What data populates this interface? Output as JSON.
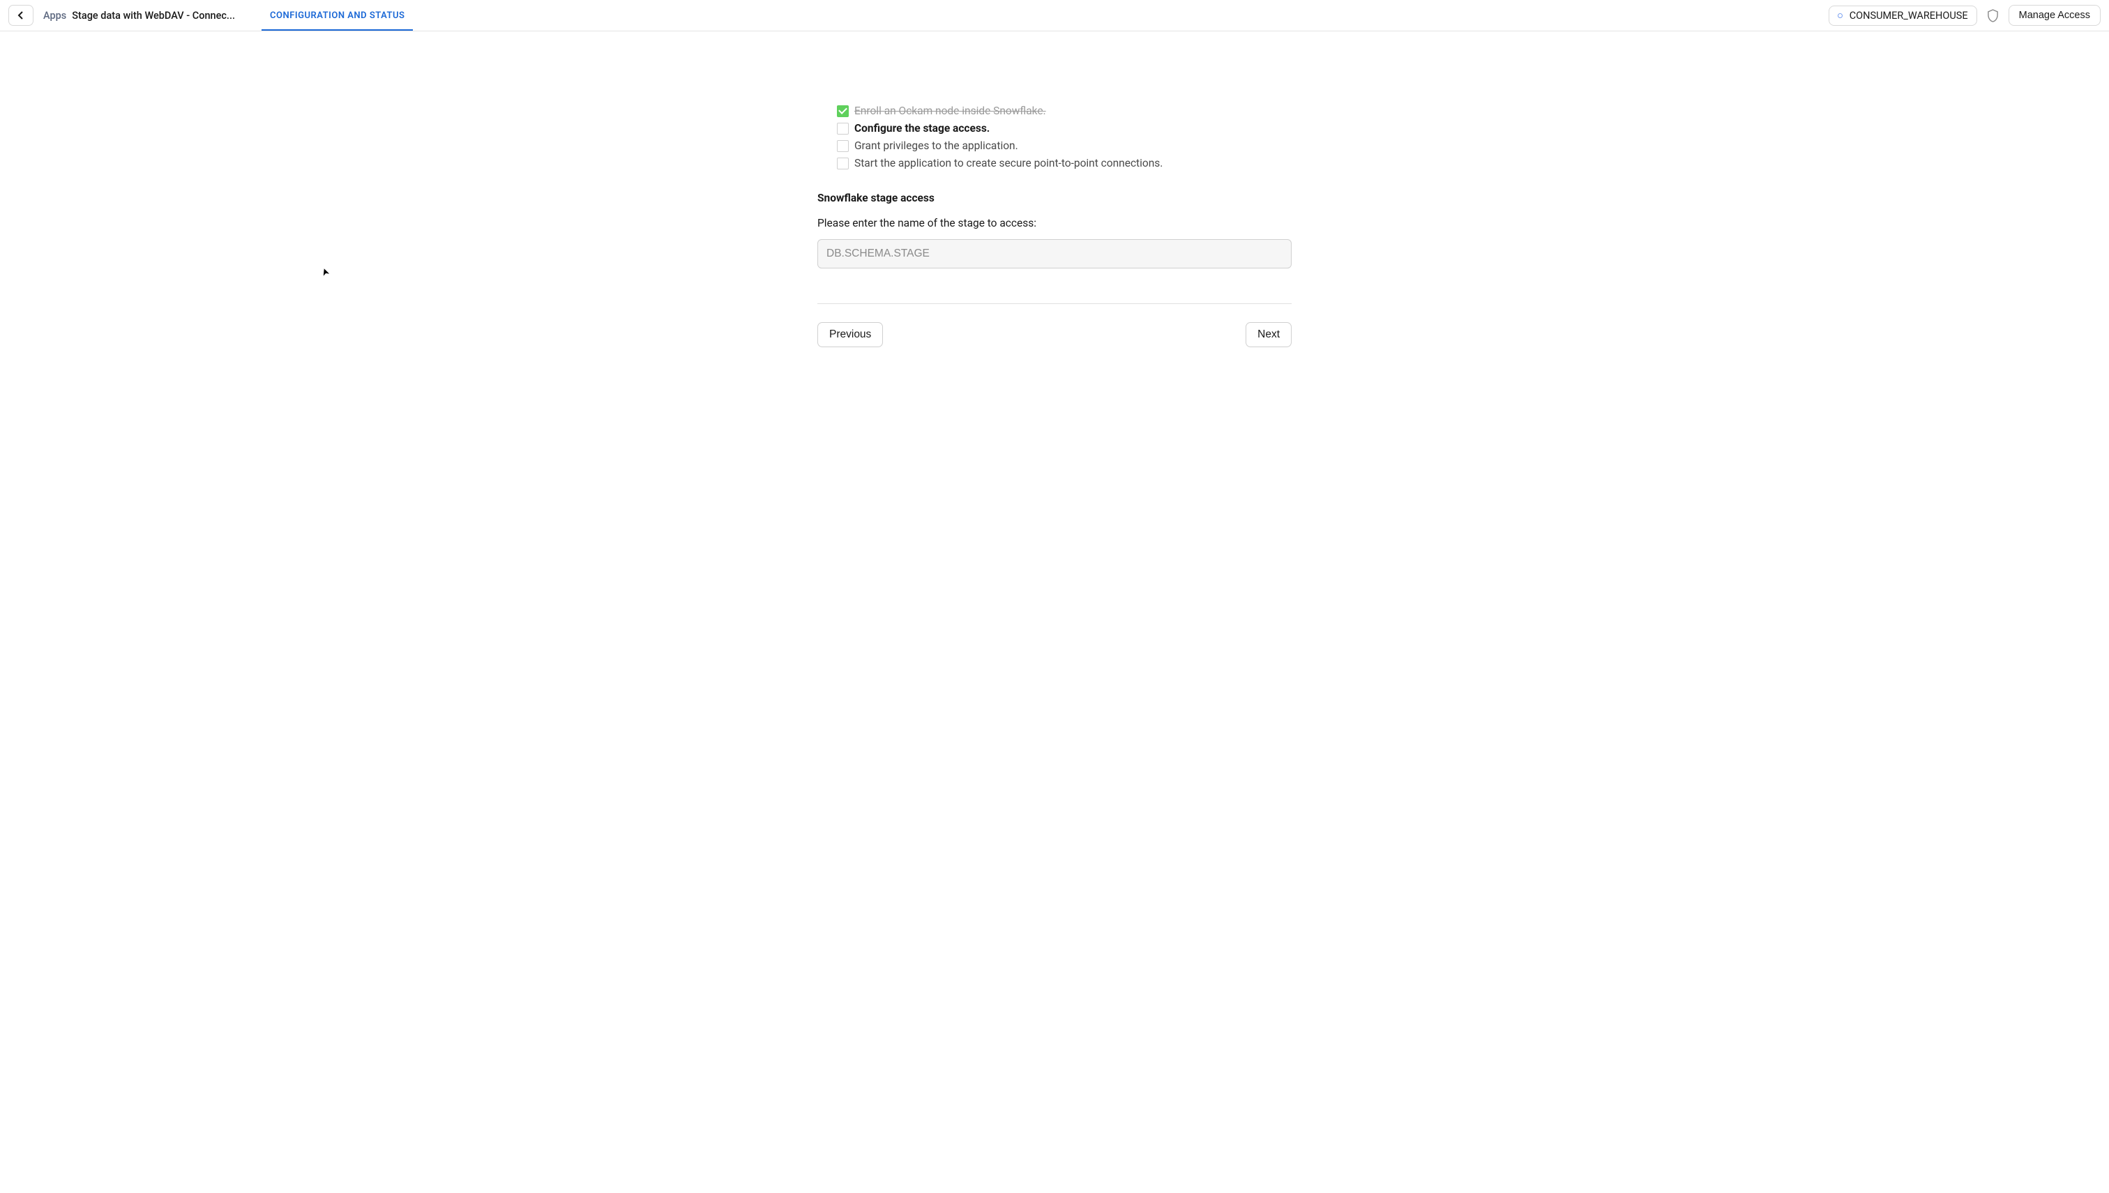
{
  "header": {
    "breadcrumb_apps": "Apps",
    "breadcrumb_current": "Stage data with WebDAV - Connec...",
    "tab_label": "CONFIGURATION AND STATUS",
    "warehouse_name": "CONSUMER_WAREHOUSE",
    "manage_access_label": "Manage Access"
  },
  "steps": [
    {
      "label": "Enroll an Ockam node inside Snowflake.",
      "status": "completed"
    },
    {
      "label": "Configure the stage access.",
      "status": "current"
    },
    {
      "label": "Grant privileges to the application.",
      "status": "pending"
    },
    {
      "label": "Start the application to create secure point-to-point connections.",
      "status": "pending"
    }
  ],
  "section": {
    "title": "Snowflake stage access",
    "label": "Please enter the name of the stage to access:",
    "input_placeholder": "DB.SCHEMA.STAGE",
    "input_value": ""
  },
  "nav": {
    "previous_label": "Previous",
    "next_label": "Next"
  }
}
